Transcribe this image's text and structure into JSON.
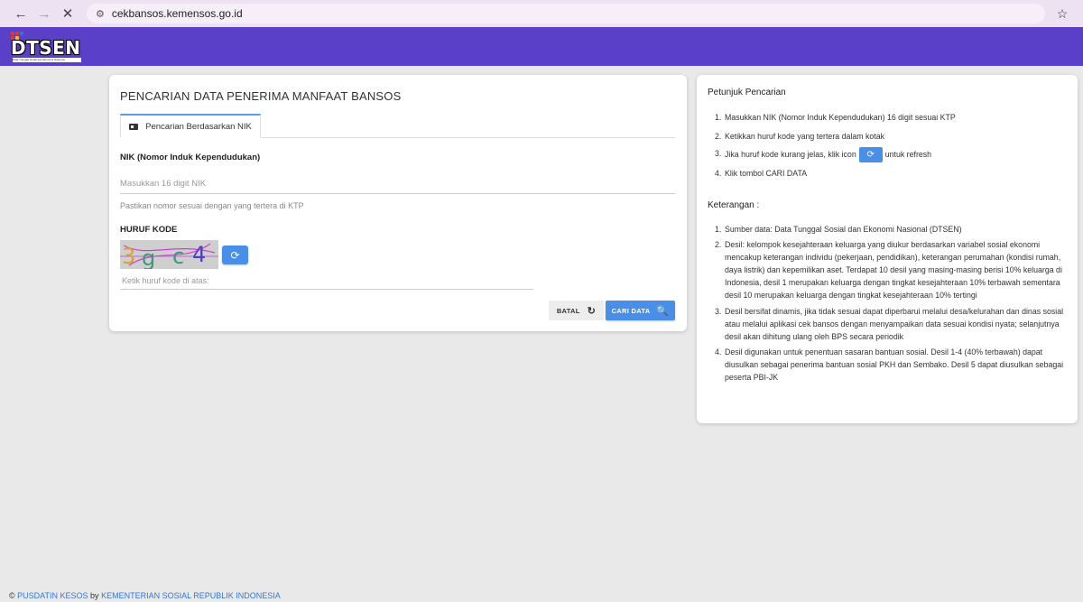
{
  "browser": {
    "url": "cekbansos.kemensos.go.id",
    "back_icon": "←",
    "forward_icon": "→",
    "close_icon": "✕",
    "site_icon": "⚙",
    "star_icon": "☆"
  },
  "header": {
    "logo_text": "DTSEN",
    "logo_subtitle": "Data Tunggal Sosial dan Ekonomi Nasional",
    "background_color": "#5a40c8"
  },
  "search": {
    "title": "PENCARIAN DATA PENERIMA MANFAAT BANSOS",
    "tab_label": "Pencarian Berdasarkan NIK",
    "nik_label": "NIK (Nomor Induk Kependudukan)",
    "nik_placeholder": "Masukkan 16 digit NIK",
    "nik_help": "Pastikan nomor sesuai dengan yang tertera di KTP",
    "kode_label": "HURUF KODE",
    "captcha_text": "3gc4",
    "kode_placeholder": "Ketik huruf kode di atas:",
    "batal_label": "BATAL",
    "batal_icon": "↻",
    "cari_label": "CARI DATA",
    "cari_icon": "🔍",
    "refresh_icon": "⟳",
    "accent_color": "#4a8fe7"
  },
  "petunjuk": {
    "title": "Petunjuk Pencarian",
    "items": [
      "Masukkan NIK (Nomor Induk Kependudukan) 16 digit sesuai KTP",
      "Ketikkan huruf kode yang tertera dalam kotak",
      "Jika huruf kode kurang jelas, klik icon",
      "Klik tombol CARI DATA"
    ],
    "item3_suffix": "untuk refresh"
  },
  "keterangan": {
    "title": "Keterangan :",
    "items": [
      "Sumber data: Data Tunggal Sosial dan Ekonomi Nasional (DTSEN)",
      "Desil: kelompok kesejahteraan keluarga yang diukur berdasarkan variabel sosial ekonomi mencakup keterangan individu (pekerjaan, pendidikan), keterangan perumahan (kondisi rumah, daya listrik) dan kepemilikan aset. Terdapat 10 desil yang masing-masing berisi 10% keluarga di Indonesia, desil 1 merupakan keluarga dengan tingkat kesejahteraan 10% terbawah sementara desil 10 merupakan keluarga dengan tingkat kesejahteraan 10% tertingi",
      "Desil bersifat dinamis, jika tidak sesuai dapat diperbarui melalui desa/kelurahan dan dinas sosial atau melalui aplikasi cek bansos dengan menyampaikan data sesuai kondisi nyata; selanjutnya desil akan dihitung ulang oleh BPS secara periodik",
      "Desil digunakan untuk penentuan sasaran bantuan sosial. Desil 1-4 (40% terbawah) dapat diusulkan sebagai penerima bantuan sosial PKH dan Sembako. Desil 5 dapat diusulkan sebagai peserta PBI-JK"
    ]
  },
  "footer": {
    "copyright": "©",
    "org": "PUSDATIN KESOS",
    "by": "by",
    "ministry": "KEMENTERIAN SOSIAL REPUBLIK INDONESIA"
  }
}
